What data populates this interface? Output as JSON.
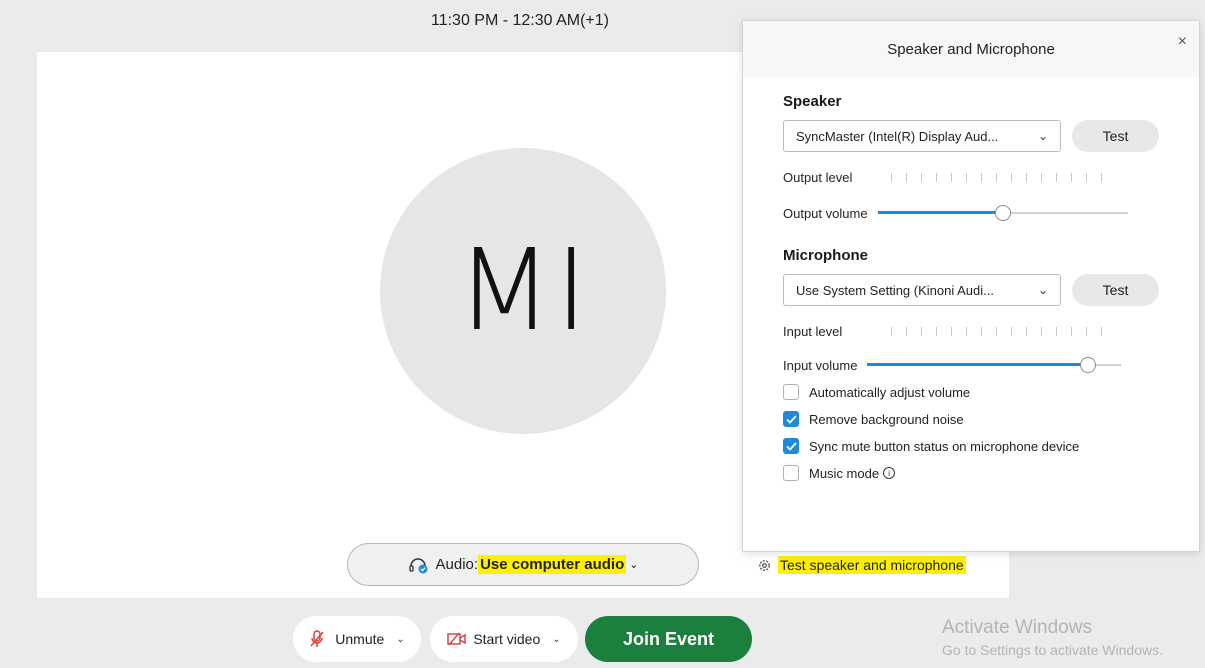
{
  "meeting": {
    "time_range": "11:30 PM - 12:30 AM(+1)",
    "avatar_initials": "MI"
  },
  "audio_pill": {
    "prefix": "Audio:",
    "value": "Use computer audio"
  },
  "test_link": {
    "label": "Test speaker and microphone"
  },
  "controls": {
    "unmute_label": "Unmute",
    "start_video_label": "Start video",
    "join_label": "Join Event"
  },
  "watermark": {
    "title": "Activate Windows",
    "subtitle": "Go to Settings to activate Windows."
  },
  "panel": {
    "title": "Speaker and Microphone",
    "close_icon": "×",
    "speaker": {
      "title": "Speaker",
      "device": "SyncMaster (Intel(R) Display Aud...",
      "test_label": "Test",
      "level_label": "Output level",
      "volume_label": "Output volume",
      "volume_fraction": 0.5
    },
    "microphone": {
      "title": "Microphone",
      "device": "Use System Setting (Kinoni Audi...",
      "test_label": "Test",
      "level_label": "Input level",
      "volume_label": "Input volume",
      "volume_fraction": 0.87
    },
    "options": [
      {
        "label": "Automatically adjust volume",
        "checked": false
      },
      {
        "label": "Remove background noise",
        "checked": true
      },
      {
        "label": "Sync mute button status on microphone device",
        "checked": true
      },
      {
        "label": "Music mode",
        "checked": false
      }
    ]
  },
  "colors": {
    "accent_blue": "#1f8ad9",
    "join_green": "#1b7f3d",
    "highlight_yellow": "#fff000",
    "mute_red": "#d93a3a"
  }
}
